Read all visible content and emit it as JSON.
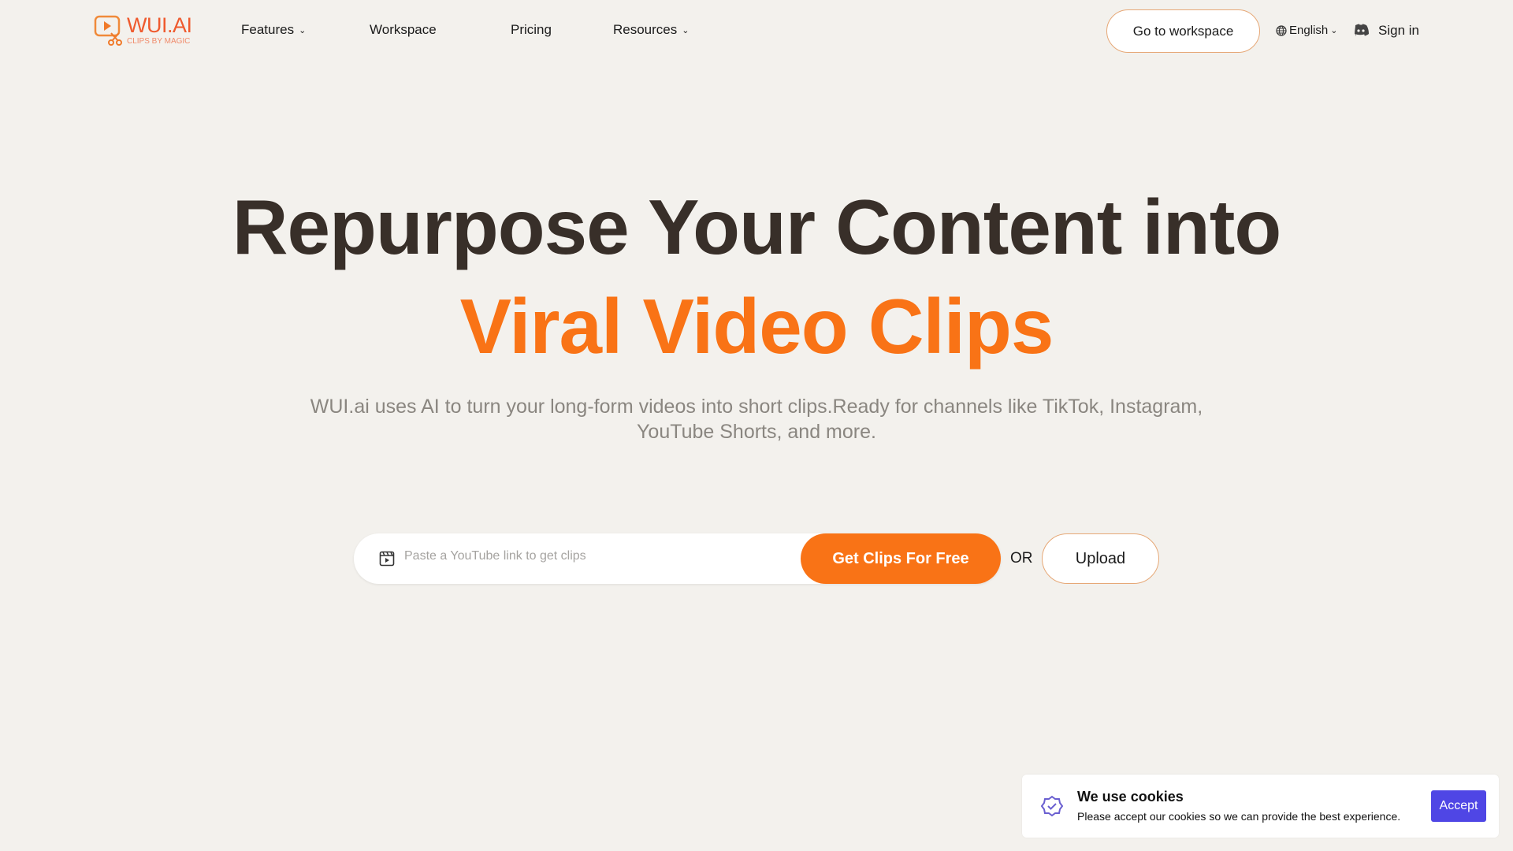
{
  "header": {
    "logo": {
      "name": "WUI.AI",
      "tagline": "CLIPS BY MAGIC"
    },
    "nav": [
      {
        "label": "Features",
        "dropdown": true
      },
      {
        "label": "Workspace"
      },
      {
        "label": "Pricing"
      },
      {
        "label": "Resources",
        "dropdown": true
      }
    ],
    "go_to_workspace": "Go to workspace",
    "language": "English",
    "sign_in": "Sign in"
  },
  "hero": {
    "title_line1": "Repurpose Your Content into",
    "title_line2": "Viral Video Clips",
    "subtitle": "WUI.ai uses AI to turn your long-form videos into short clips.Ready for channels like TikTok, Instagram, YouTube Shorts, and more.",
    "input_placeholder": "Paste a YouTube link to get clips",
    "cta": "Get Clips For Free",
    "or": "OR",
    "upload": "Upload"
  },
  "cookie": {
    "title": "We use cookies",
    "text": "Please accept our cookies so we can provide the best experience.",
    "accept": "Accept"
  },
  "colors": {
    "accent": "#f97316",
    "heading": "#382f29",
    "background": "#f3f1ed",
    "cookie_button": "#4f46e5"
  }
}
